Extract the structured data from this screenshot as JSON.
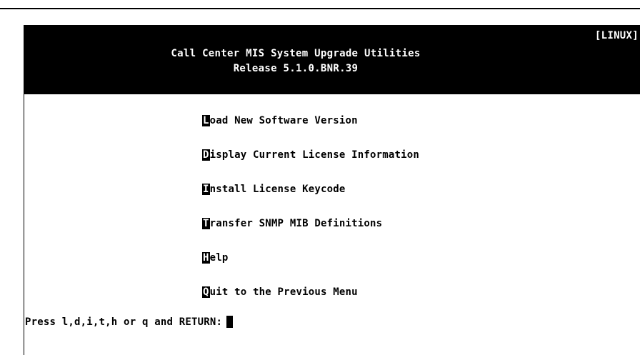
{
  "header": {
    "os_tag": "[LINUX]",
    "title_line1": "Call Center MIS System Upgrade Utilities",
    "title_line2": "Release 5.1.0.BNR.39"
  },
  "menu": {
    "items": [
      {
        "hotkey": "L",
        "rest": "oad New Software Version"
      },
      {
        "hotkey": "D",
        "rest": "isplay Current License Information"
      },
      {
        "hotkey": "I",
        "rest": "nstall License Keycode"
      },
      {
        "hotkey": "T",
        "rest": "ransfer SNMP MIB Definitions"
      },
      {
        "hotkey": "H",
        "rest": "elp"
      },
      {
        "hotkey": "Q",
        "rest": "uit to the Previous Menu"
      }
    ]
  },
  "prompt": {
    "text": "Press l,d,i,t,h or q and RETURN:"
  },
  "colors": {
    "background": "#ffffff",
    "header_bg": "#000000",
    "text": "#000000",
    "header_text": "#ffffff"
  }
}
